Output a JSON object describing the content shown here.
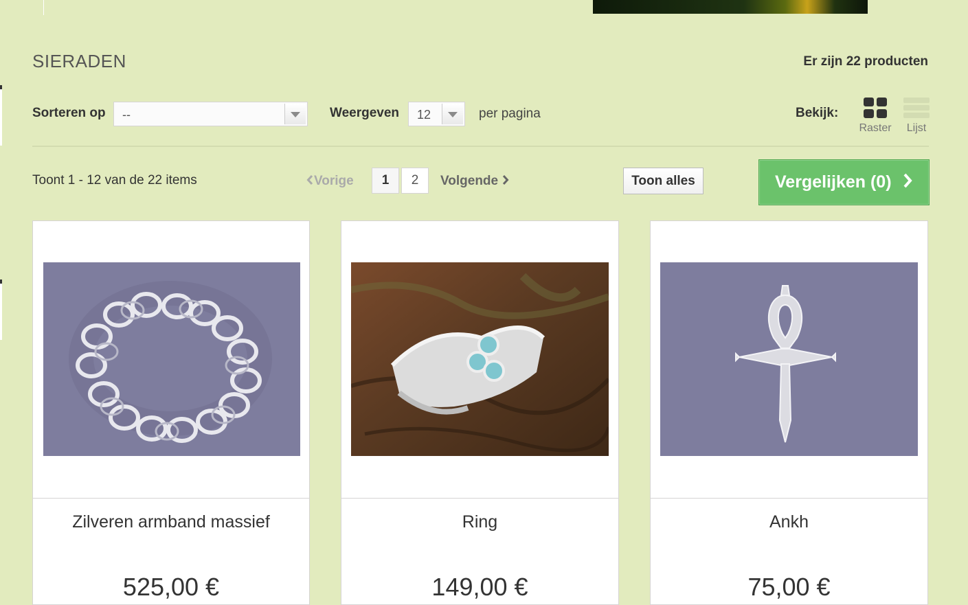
{
  "category": {
    "title": "SIERADEN",
    "count_text": "Er zijn 22 producten"
  },
  "sort": {
    "label": "Sorteren op",
    "selected": "--"
  },
  "display": {
    "label": "Weergeven",
    "selected": "12",
    "suffix": "per pagina"
  },
  "view": {
    "label": "Bekijk:",
    "grid_label": "Raster",
    "list_label": "Lijst",
    "active": "grid"
  },
  "pagination": {
    "showing_text": "Toont 1 - 12 van de 22 items",
    "prev_label": "Vorige",
    "pages": [
      "1",
      "2"
    ],
    "current_page": "1",
    "next_label": "Volgende",
    "show_all_label": "Toon alles"
  },
  "compare": {
    "label": "Vergelijken (0)"
  },
  "products": [
    {
      "name": "Zilveren armband massief",
      "price": "525,00 €",
      "image": "silver-bracelet-photo"
    },
    {
      "name": "Ring",
      "price": "149,00 €",
      "image": "silver-ring-turquoise-photo"
    },
    {
      "name": "Ankh",
      "price": "75,00 €",
      "image": "ankh-pendant-photo"
    }
  ],
  "colors": {
    "background": "#e2ebbe",
    "compare_green": "#6bc26b",
    "photo_purple": "#7e7d9e"
  }
}
